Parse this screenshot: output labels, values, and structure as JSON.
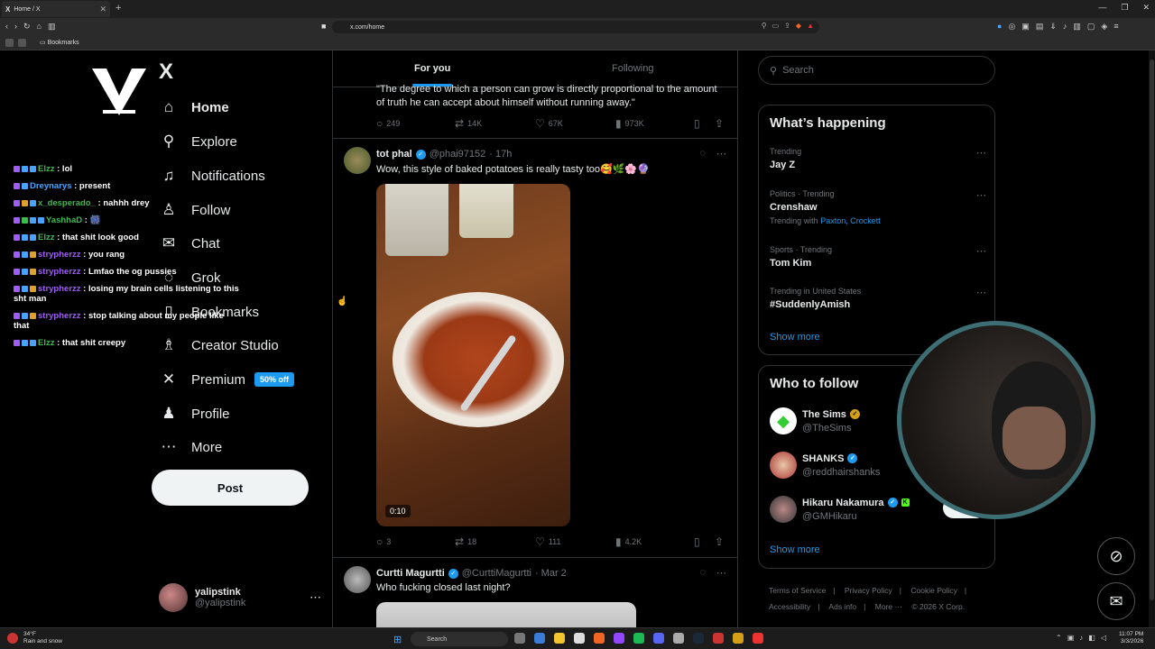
{
  "browser": {
    "tab_title": "Home / X",
    "tab_logo": "X",
    "url": "x.com/home",
    "bookmarks_label": "Bookmarks"
  },
  "nav": {
    "x_logo": "X",
    "items": [
      {
        "label": "Home",
        "icon": "home-icon",
        "glyph": "⌂"
      },
      {
        "label": "Explore",
        "icon": "search-icon",
        "glyph": "⚲"
      },
      {
        "label": "Notifications",
        "icon": "bell-icon",
        "glyph": "♫"
      },
      {
        "label": "Follow",
        "icon": "person-add-icon",
        "glyph": "♙"
      },
      {
        "label": "Chat",
        "icon": "mail-icon",
        "glyph": "✉"
      },
      {
        "label": "Grok",
        "icon": "grok-icon",
        "glyph": "◌"
      },
      {
        "label": "Bookmarks",
        "icon": "bookmark-icon",
        "glyph": "▯"
      },
      {
        "label": "Creator Studio",
        "icon": "creator-icon",
        "glyph": "♗"
      },
      {
        "label": "Premium",
        "icon": "x-icon",
        "glyph": "✕",
        "badge": "50% off"
      },
      {
        "label": "Profile",
        "icon": "profile-icon",
        "glyph": "♟"
      },
      {
        "label": "More",
        "icon": "more-icon",
        "glyph": "⋯"
      }
    ],
    "post_label": "Post",
    "account": {
      "name": "yalipstink",
      "handle": "@yalipstink",
      "menu": "⋯"
    }
  },
  "chat": [
    {
      "user": "Elzz",
      "color": "#3fb950",
      "msg": ": lol"
    },
    {
      "user": "Dreynarys",
      "color": "#4aa3ff",
      "msg": ": present"
    },
    {
      "user": "x_desperado_",
      "color": "#3fb950",
      "msg": ": nahhh drey"
    },
    {
      "user": "YashhaD",
      "color": "#3fb950",
      "msg": ": 🎆"
    },
    {
      "user": "Elzz",
      "color": "#3fb950",
      "msg": ": that shit look good"
    },
    {
      "user": "strypherzz",
      "color": "#9f5cf7",
      "msg": ": you rang"
    },
    {
      "user": "strypherzz",
      "color": "#9f5cf7",
      "msg": ": Lmfao the og pussies"
    },
    {
      "user": "strypherzz",
      "color": "#9f5cf7",
      "msg": ": losing my brain cells listening to this sht man"
    },
    {
      "user": "strypherzz",
      "color": "#9f5cf7",
      "msg": ": stop talking about my people like that"
    },
    {
      "user": "Elzz",
      "color": "#3fb950",
      "msg": ": that shit creepy"
    }
  ],
  "timeline": {
    "tabs": [
      "For you",
      "Following"
    ],
    "quote": "\"The degree to which a person can grow is directly proportional to the amount of truth he can accept about himself without running away.\"",
    "quote_actions": {
      "replies": "249",
      "reposts": "14K",
      "likes": "67K",
      "views": "973K"
    },
    "tweet1": {
      "name": "tot phal",
      "handle": "@phai97152",
      "time": "· 17h",
      "text": "Wow, this style of baked potatoes is really tasty too🥰🌿🌸🔮",
      "duration": "0:10",
      "actions": {
        "replies": "3",
        "reposts": "18",
        "likes": "111",
        "views": "4.2K"
      }
    },
    "tweet2": {
      "name": "Curtti Magurtti",
      "handle": "@CurttiMagurtti",
      "time": "· Mar 2",
      "text": "Who fucking closed last night?"
    }
  },
  "right": {
    "search_placeholder": "Search",
    "whats_happening": "What’s happening",
    "trends": [
      {
        "meta": "Trending",
        "title": "Jay Z"
      },
      {
        "meta": "Politics · Trending",
        "title": "Crenshaw",
        "with_label": "Trending with",
        "with_links": "Paxton, Crockett"
      },
      {
        "meta": "Sports · Trending",
        "title": "Tom Kim"
      },
      {
        "meta": "Trending in United States",
        "title": "#SuddenlyAmish"
      }
    ],
    "show_more": "Show more",
    "who_to_follow": "Who to follow",
    "follows": [
      {
        "name": "The Sims",
        "handle": "@TheSims"
      },
      {
        "name": "SHANKS",
        "handle": "@reddhairshanks"
      },
      {
        "name": "Hikaru Nakamura",
        "handle": "@GMHikaru"
      }
    ],
    "follow_label": "Follo",
    "footer": [
      "Terms of Service",
      "|",
      "Privacy Policy",
      "|",
      "Cookie Policy",
      "|",
      "Accessibility",
      "|",
      "Ads info",
      "|",
      "More ···",
      "© 2026 X Corp."
    ]
  },
  "taskbar": {
    "weather_temp": "34°F",
    "weather_desc": "Rain and snow",
    "search_placeholder": "Search",
    "time": "11:07 PM",
    "date": "3/3/2026"
  },
  "colors": {
    "accent": "#1d9bf0",
    "background": "#000000",
    "border": "#2f3336",
    "muted_text": "#71767b"
  }
}
